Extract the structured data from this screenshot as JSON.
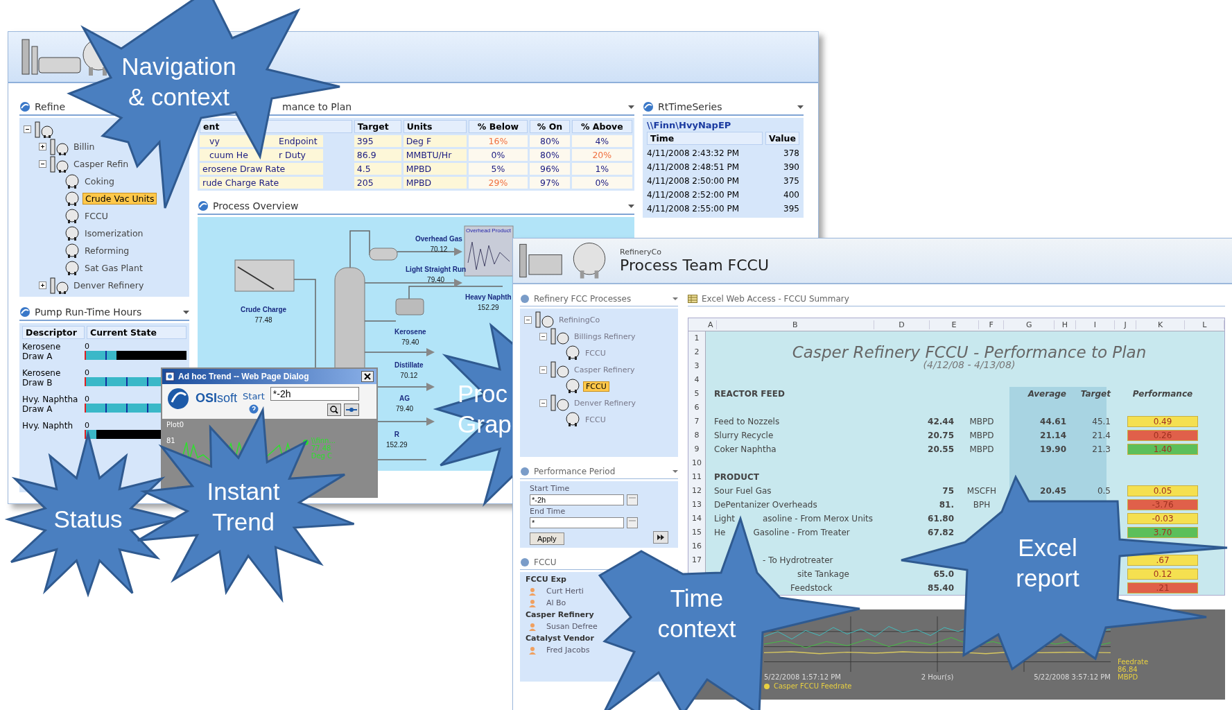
{
  "portal": {
    "tree": {
      "title": "Refine",
      "root": {
        "expanded": true,
        "children": [
          {
            "label": "Billin",
            "expanded": false,
            "selected": false
          },
          {
            "label": "Casper Refin",
            "expanded": true,
            "selected": false,
            "children": [
              {
                "label": "Coking",
                "selected": false
              },
              {
                "label": "Crude Vac Units",
                "selected": true
              },
              {
                "label": "FCCU",
                "selected": false
              },
              {
                "label": "Isomerization",
                "selected": false
              },
              {
                "label": "Reforming",
                "selected": false
              },
              {
                "label": "Sat Gas Plant",
                "selected": false
              }
            ]
          },
          {
            "label": "Denver Refinery",
            "expanded": false,
            "selected": false
          }
        ]
      }
    },
    "pump": {
      "title": "Pump Run-Time Hours",
      "columns": [
        "Descriptor",
        "Current State"
      ],
      "rows": [
        {
          "descriptor": "Kerosene Draw A",
          "reading": "0",
          "level": 0.3
        },
        {
          "descriptor": "Kerosene Draw B",
          "reading": "0",
          "level": 1
        },
        {
          "descriptor": "Hvy. Naphtha Draw A",
          "reading": "0",
          "level": 1
        },
        {
          "descriptor": "Hvy. Naphth",
          "reading": "0",
          "level": 0.1
        }
      ]
    },
    "plan": {
      "title": "mance to Plan",
      "columns": [
        "ent",
        "Target",
        "Units",
        "% Below",
        "% On",
        "% Above"
      ],
      "rows": [
        {
          "measure": [
            "vy",
            "Endpoint"
          ],
          "target": "395",
          "units": "Deg F",
          "below": {
            "text": "16%",
            "alert": true
          },
          "on": {
            "text": "80%",
            "alert": false
          },
          "above": {
            "text": "4%",
            "alert": false
          }
        },
        {
          "measure": [
            "cuum He",
            "r Duty"
          ],
          "target": "86.9",
          "units": "MMBTU/Hr",
          "below": {
            "text": "0%",
            "alert": false
          },
          "on": {
            "text": "80%",
            "alert": false
          },
          "above": {
            "text": "20%",
            "alert": true
          }
        },
        {
          "measure": [
            "erosene Draw Rate"
          ],
          "target": "4.5",
          "units": "MPBD",
          "below": {
            "text": "5%",
            "alert": false
          },
          "on": {
            "text": "96%",
            "alert": false
          },
          "above": {
            "text": "1%",
            "alert": false
          }
        },
        {
          "measure": [
            "rude Charge Rate"
          ],
          "target": "205",
          "units": "MPBD",
          "below": {
            "text": "29%",
            "alert": true
          },
          "on": {
            "text": "97%",
            "alert": false
          },
          "above": {
            "text": "0%",
            "alert": false
          }
        }
      ]
    },
    "process": {
      "title": "Process Overview",
      "streams": [
        {
          "name": "Overhead Gas",
          "value": "70.12"
        },
        {
          "name": "Light Straight Run",
          "value": "79.40"
        },
        {
          "name": "Crude Charge",
          "value": "77.48"
        },
        {
          "name": "Heavy Naphth",
          "value": "152.29"
        },
        {
          "name": "Kerosene",
          "value": "79.40"
        },
        {
          "name": "Distillate",
          "value": "70.12"
        },
        {
          "name": "AG",
          "value": "79.40"
        },
        {
          "name": "R",
          "value": "152.29"
        }
      ],
      "mini_trend": {
        "title": "Overhead Product"
      }
    },
    "rt": {
      "title": "RtTimeSeries",
      "tag": "\\\\Finn\\HvyNapEP",
      "columns": [
        "Time",
        "Value"
      ],
      "rows": [
        [
          "4/11/2008 2:43:32 PM",
          "378"
        ],
        [
          "4/11/2008 2:48:51 PM",
          "390"
        ],
        [
          "4/11/2008 2:50:00 PM",
          "375"
        ],
        [
          "4/11/2008 2:52:00 PM",
          "400"
        ],
        [
          "4/11/2008 2:55:00 PM",
          "395"
        ]
      ]
    }
  },
  "dialog": {
    "title": "Ad hoc Trend -- Web Page Dialog",
    "logo": "**OSI**soft",
    "start_label": "Start",
    "start_value": "*-2h",
    "plot": {
      "title": "Plot0",
      "yticks": [
        "81"
      ],
      "legend": [
        "\\\\finn...",
        "77.48",
        "Deg C"
      ]
    }
  },
  "team": {
    "company": "RefineryCo",
    "title": "Process Team FCCU",
    "tree": {
      "title": "Refinery FCC Processes",
      "root": {
        "label": "RefiningCo",
        "expanded": true,
        "selected": false,
        "children": [
          {
            "label": "Billings Refinery",
            "expanded": true,
            "selected": false,
            "children": [
              {
                "label": "FCCU",
                "selected": false
              }
            ]
          },
          {
            "label": "Casper Refinery",
            "expanded": true,
            "selected": false,
            "children": [
              {
                "label": "FCCU",
                "selected": true
              }
            ]
          },
          {
            "label": "Denver Refinery",
            "expanded": true,
            "selected": false,
            "children": [
              {
                "label": "FCCU",
                "selected": false
              }
            ]
          }
        ]
      }
    },
    "period": {
      "title": "Performance Period",
      "start_label": "Start Time",
      "start_value": "*-2h",
      "end_label": "End Time",
      "end_value": "*",
      "apply": "Apply"
    },
    "experts": {
      "title": "FCCU",
      "groups": [
        {
          "name": "FCCU Exp",
          "members": [
            "Curt Herti",
            "Al Bo"
          ]
        },
        {
          "name": "Casper Refinery",
          "members": [
            "Susan Defree"
          ]
        },
        {
          "name": "Catalyst Vendor",
          "members": [
            "Fred Jacobs"
          ]
        }
      ]
    },
    "excel": {
      "title": "Excel Web Access - FCCU Summary",
      "columns": [
        "A",
        "B",
        "D",
        "E",
        "F",
        "G",
        "H",
        "I",
        "J",
        "K",
        "L"
      ],
      "row_numbers": [
        "1",
        "2",
        "3",
        "4",
        "5",
        "6",
        "7",
        "8",
        "9",
        "10",
        "11",
        "12",
        "13",
        "14",
        "15",
        "16",
        "17"
      ],
      "heading": "Casper Refinery FCCU - Performance to Plan",
      "subheading": "(4/12/08 - 4/13/08)",
      "sections": [
        {
          "name": "REACTOR FEED",
          "headers": [
            "Average",
            "Target",
            "Performance"
          ],
          "rows": [
            {
              "label": [
                "Feed to Nozzels"
              ],
              "actual": "42.44",
              "unit": "MBPD",
              "average": "44.61",
              "target": "45.1",
              "performance": "0.49",
              "color": "#f5e050"
            },
            {
              "label": [
                "Slurry Recycle"
              ],
              "actual": "20.75",
              "unit": "MBPD",
              "average": "21.14",
              "target": "21.4",
              "performance": "0.26",
              "color": "#e0604a"
            },
            {
              "label": [
                "Coker Naphtha"
              ],
              "actual": "20.55",
              "unit": "MBPD",
              "average": "19.90",
              "target": "21.3",
              "performance": "1.40",
              "color": "#5cbf5a"
            }
          ]
        },
        {
          "name": "PRODUCT",
          "rows": [
            {
              "label": [
                "Sour Fuel Gas"
              ],
              "actual": "75",
              "unit": "MSCFH",
              "average": "20.45",
              "target": "0.5",
              "performance": "0.05",
              "color": "#f5e050"
            },
            {
              "label": [
                "DePentanizer Overheads"
              ],
              "actual": "81.",
              "unit": "BPH",
              "performance": "-3.76",
              "color": "#e0604a"
            },
            {
              "label": [
                "Light",
                "asoline - From Merox Units"
              ],
              "actual": "61.80",
              "performance": "-0.03",
              "color": "#f5e050"
            },
            {
              "label": [
                "He",
                "Gasoline - From Treater"
              ],
              "actual": "67.82",
              "performance": "3.70",
              "color": "#5cbf5a"
            }
          ]
        },
        {
          "rows": [
            {
              "label": [
                "- To Hydrotreater"
              ],
              "performance": ".67",
              "color": "#f5e050"
            },
            {
              "label": [
                "site Tankage"
              ],
              "actual": "65.0",
              "performance": "0.12",
              "color": "#f5e050"
            },
            {
              "label": [
                "Feedstock"
              ],
              "actual": "85.40",
              "performance": ".21",
              "color": "#e0604a"
            }
          ]
        }
      ]
    },
    "trend": {
      "start": "5/22/2008 1:57:12 PM",
      "span": "2 Hour(s)",
      "end": "5/22/2008 3:57:12 PM",
      "legend": [
        "Casper FCCU Feedrate"
      ],
      "readout": [
        "Feedrate",
        "86.84",
        "MBPD"
      ]
    }
  },
  "callouts": [
    {
      "lines": [
        "Navigation",
        "& context"
      ]
    },
    {
      "lines": [
        "Status"
      ]
    },
    {
      "lines": [
        "Instant",
        "Trend"
      ]
    },
    {
      "lines": [
        "Proc",
        "Grap"
      ]
    },
    {
      "lines": [
        "Time",
        "context"
      ]
    },
    {
      "lines": [
        "Excel",
        "report"
      ]
    }
  ]
}
